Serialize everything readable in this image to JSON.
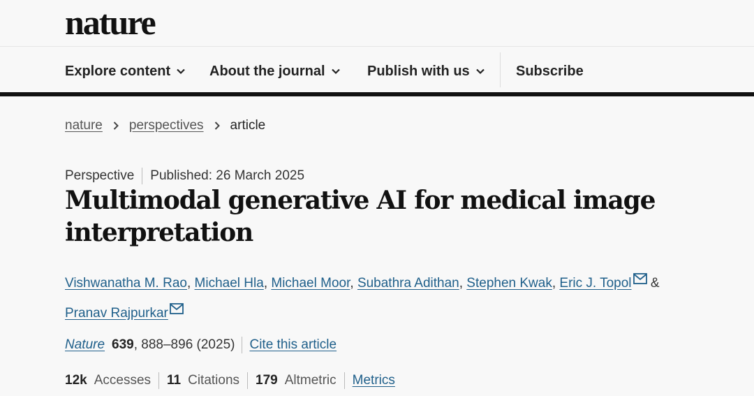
{
  "logo": {
    "text": "nature"
  },
  "nav": {
    "items": [
      {
        "label": "Explore content",
        "icon": "chevron-down-icon"
      },
      {
        "label": "About the journal",
        "icon": "chevron-down-icon"
      },
      {
        "label": "Publish with us",
        "icon": "chevron-down-icon"
      }
    ],
    "subscribe_label": "Subscribe"
  },
  "breadcrumb": {
    "items": [
      "nature",
      "perspectives"
    ],
    "current": "article"
  },
  "article": {
    "type": "Perspective",
    "published": "Published: 26 March 2025",
    "title": "Multimodal generative AI for medical image interpretation",
    "authors": [
      {
        "name": "Vishwanatha M. Rao"
      },
      {
        "name": "Michael Hla"
      },
      {
        "name": "Michael Moor"
      },
      {
        "name": "Subathra Adithan"
      },
      {
        "name": "Stephen Kwak"
      },
      {
        "name": "Eric J. Topol",
        "mail": true
      },
      {
        "name": "Pranav Rajpurkar",
        "mail": true
      }
    ],
    "author_separator": ",",
    "author_conjunction": "&",
    "citation": {
      "journal": "Nature",
      "volume": "639",
      "pages": ", 888–896 (2025)",
      "cite_link": "Cite this article"
    },
    "metrics": {
      "accesses_value": "12k",
      "accesses_label": "Accesses",
      "citations_value": "11",
      "citations_label": "Citations",
      "altmetric_value": "179",
      "altmetric_label": "Altmetric",
      "metrics_link": "Metrics"
    }
  },
  "colors": {
    "link": "#1f5f8a",
    "rule": "#111111",
    "background": "#f8f8f8"
  }
}
